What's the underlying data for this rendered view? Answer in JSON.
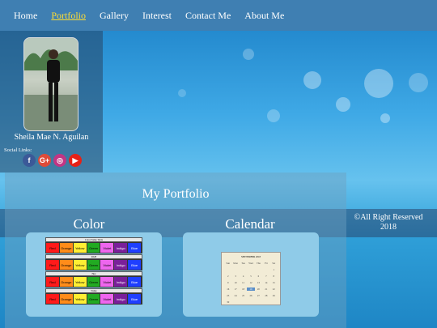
{
  "nav": {
    "items": [
      {
        "label": "Home",
        "active": false
      },
      {
        "label": "Portfolio",
        "active": true
      },
      {
        "label": "Gallery",
        "active": false
      },
      {
        "label": "Interest",
        "active": false
      },
      {
        "label": "Contact Me",
        "active": false
      },
      {
        "label": "About Me",
        "active": false
      }
    ]
  },
  "profile": {
    "name": "Sheila Mae N. Aguilan",
    "social_label": "Social Links:",
    "social": [
      {
        "icon": "facebook-icon",
        "glyph": "f",
        "color": "#3b5998"
      },
      {
        "icon": "google-plus-icon",
        "glyph": "G+",
        "color": "#dd4b39"
      },
      {
        "icon": "instagram-icon",
        "glyph": "◎",
        "color": "#c13584"
      },
      {
        "icon": "youtube-icon",
        "glyph": "▶",
        "color": "#e62117"
      }
    ]
  },
  "main": {
    "title": "My Portfolio",
    "col1": "Color",
    "col2": "Calendar"
  },
  "footer": {
    "line1": "©All Right Reserved",
    "line2": "2018"
  },
  "colors": {
    "rows": [
      {
        "label": "Color Name Table",
        "cells": [
          "Red",
          "Orange",
          "Yellow",
          "Green",
          "Violet",
          "Indigo",
          "Blue"
        ]
      },
      {
        "label": "RGB",
        "cells": [
          "Red",
          "Orange",
          "Yellow",
          "Green",
          "Violet",
          "Indigo",
          "Blue"
        ]
      },
      {
        "label": "Hex",
        "cells": [
          "Red",
          "Orange",
          "Yellow",
          "Green",
          "Violet",
          "Indigo",
          "Blue"
        ]
      },
      {
        "label": "Name",
        "cells": [
          "Red",
          "Orange",
          "Yellow",
          "Green",
          "Violet",
          "Indigo",
          "Blue"
        ]
      }
    ],
    "swatch": [
      "#ff1a1a",
      "#ff8c1a",
      "#ffee33",
      "#22aa22",
      "#ee66ee",
      "#7a1f9a",
      "#1f3fff"
    ]
  },
  "calendar": {
    "title": "SEPTEMBER 2018",
    "days": [
      "Sun",
      "Mon",
      "Tue",
      "Wed",
      "Thu",
      "Fri",
      "Sat"
    ],
    "dates": [
      "",
      "",
      "",
      "",
      "",
      "",
      "1",
      "2",
      "3",
      "4",
      "5",
      "6",
      "7",
      "8",
      "9",
      "10",
      "11",
      "12",
      "13",
      "14",
      "15",
      "16",
      "17",
      "18",
      "19",
      "20",
      "21",
      "22",
      "23",
      "24",
      "25",
      "26",
      "27",
      "28",
      "29",
      "30"
    ],
    "highlight": "19"
  }
}
